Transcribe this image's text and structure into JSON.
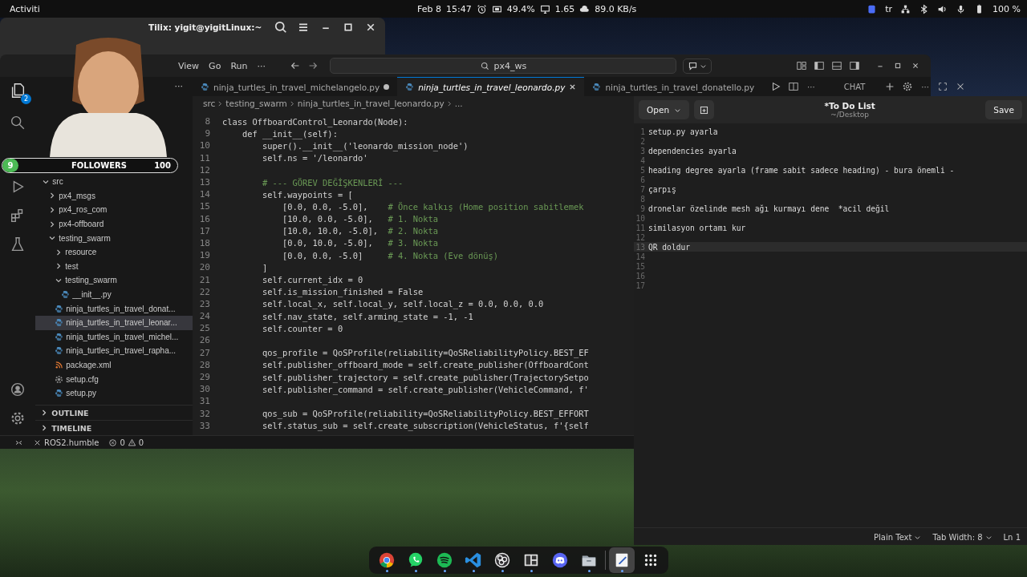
{
  "top_bar": {
    "activities": "Activiti",
    "date": "Feb 8",
    "time": "15:47",
    "indicators": [
      {
        "kind": "alarm"
      },
      {
        "kind": "cpu",
        "text": "49.4%"
      },
      {
        "kind": "monitor",
        "text": "1.65"
      },
      {
        "kind": "cloud",
        "text": "89.0 KB/s"
      }
    ],
    "tray": [
      {
        "kind": "badge"
      },
      {
        "kind": "lang",
        "text": "tr"
      },
      {
        "kind": "network"
      },
      {
        "kind": "bluetooth"
      },
      {
        "kind": "volume"
      },
      {
        "kind": "mic"
      },
      {
        "kind": "battery",
        "text": "100 %"
      }
    ]
  },
  "tilix": {
    "title": "Tilix: yigit@yigitLinux:~"
  },
  "followers": {
    "count": "9",
    "label": "FOLLOWERS",
    "goal": "100",
    "level": 0.09
  },
  "vscode": {
    "menu": [
      "View",
      "Go",
      "Run",
      "···"
    ],
    "search": "px4_ws",
    "explorer_more": "···",
    "activity_badge": "2",
    "tabs": [
      {
        "label": "ninja_turtles_in_travel_michelangelo.py",
        "selected": false,
        "modified": true,
        "preview": false
      },
      {
        "label": "ninja_turtles_in_travel_leonardo.py",
        "selected": true,
        "modified": false,
        "preview": true
      },
      {
        "label": "ninja_turtles_in_travel_donatello.py",
        "selected": false,
        "modified": false,
        "preview": false
      }
    ],
    "tab_more": "···",
    "chat_label": "CHAT",
    "chat_more": "···",
    "breadcrumb": [
      "src",
      "testing_swarm",
      "ninja_turtles_in_travel_leonardo.py",
      "..."
    ],
    "explorer": {
      "items": [
        {
          "label": "src",
          "kind": "folder",
          "expanded": true,
          "selected": false,
          "children": [
            {
              "label": "px4_msgs",
              "kind": "folder",
              "expanded": false,
              "selected": false
            },
            {
              "label": "px4_ros_com",
              "kind": "folder",
              "expanded": false,
              "selected": false
            },
            {
              "label": "px4-offboard",
              "kind": "folder",
              "expanded": false,
              "selected": false
            },
            {
              "label": "testing_swarm",
              "kind": "folder",
              "expanded": true,
              "selected": false,
              "children": [
                {
                  "label": "resource",
                  "kind": "folder",
                  "expanded": false,
                  "selected": false
                },
                {
                  "label": "test",
                  "kind": "folder",
                  "expanded": false,
                  "selected": false
                },
                {
                  "label": "testing_swarm",
                  "kind": "folder",
                  "expanded": true,
                  "selected": false,
                  "children": [
                    {
                      "label": "__init__.py",
                      "kind": "python",
                      "selected": false
                    }
                  ]
                },
                {
                  "label": "ninja_turtles_in_travel_donat...",
                  "kind": "python",
                  "selected": false
                },
                {
                  "label": "ninja_turtles_in_travel_leonar...",
                  "kind": "python",
                  "selected": true
                },
                {
                  "label": "ninja_turtles_in_travel_michel...",
                  "kind": "python",
                  "selected": false
                },
                {
                  "label": "ninja_turtles_in_travel_rapha...",
                  "kind": "python",
                  "selected": false
                },
                {
                  "label": "package.xml",
                  "kind": "xml",
                  "selected": false
                },
                {
                  "label": "setup.cfg",
                  "kind": "config",
                  "selected": false
                },
                {
                  "label": "setup.py",
                  "kind": "python",
                  "selected": false
                }
              ]
            }
          ]
        }
      ]
    },
    "sections": [
      {
        "label": "OUTLINE",
        "expanded": false
      },
      {
        "label": "TIMELINE",
        "expanded": false
      }
    ],
    "code": [
      {
        "num": "8",
        "code": "class OffboardControl_Leonardo(Node):"
      },
      {
        "num": "9",
        "code": "    def __init__(self):"
      },
      {
        "num": "10",
        "code": "        super().__init__('leonardo_mission_node')"
      },
      {
        "num": "11",
        "code": "        self.ns = '/leonardo'"
      },
      {
        "num": "12"
      },
      {
        "num": "13",
        "comment": "        # --- GÖREV DEĞİŞKENLERİ ---"
      },
      {
        "num": "14",
        "code": "        self.waypoints = ["
      },
      {
        "num": "15",
        "code": "            [0.0, 0.0, -5.0],    ",
        "comment": "# Önce kalkış (Home position sabitlemek"
      },
      {
        "num": "16",
        "code": "            [10.0, 0.0, -5.0],   ",
        "comment": "# 1. Nokta"
      },
      {
        "num": "17",
        "code": "            [10.0, 10.0, -5.0],  ",
        "comment": "# 2. Nokta"
      },
      {
        "num": "18",
        "code": "            [0.0, 10.0, -5.0],   ",
        "comment": "# 3. Nokta"
      },
      {
        "num": "19",
        "code": "            [0.0, 0.0, -5.0]     ",
        "comment": "# 4. Nokta (Eve dönüş)"
      },
      {
        "num": "20",
        "code": "        ]"
      },
      {
        "num": "21",
        "code": "        self.current_idx = 0"
      },
      {
        "num": "22",
        "code": "        self.is_mission_finished = False"
      },
      {
        "num": "23",
        "code": "        self.local_x, self.local_y, self.local_z = 0.0, 0.0, 0.0"
      },
      {
        "num": "24",
        "code": "        self.nav_state, self.arming_state = -1, -1"
      },
      {
        "num": "25",
        "code": "        self.counter = 0"
      },
      {
        "num": "26"
      },
      {
        "num": "27",
        "code": "        qos_profile = QoSProfile(reliability=QoSReliabilityPolicy.BEST_EF"
      },
      {
        "num": "28",
        "code": "        self.publisher_offboard_mode = self.create_publisher(OffboardCont"
      },
      {
        "num": "29",
        "code": "        self.publisher_trajectory = self.create_publisher(TrajectorySetpo"
      },
      {
        "num": "30",
        "code": "        self.publisher_command = self.create_publisher(VehicleCommand, f'"
      },
      {
        "num": "31"
      },
      {
        "num": "32",
        "code": "        qos_sub = QoSProfile(reliability=QoSReliabilityPolicy.BEST_EFFORT"
      },
      {
        "num": "33",
        "code": "        self.status_sub = self.create_subscription(VehicleStatus, f'{self"
      }
    ],
    "status": {
      "remote": "ROS2.humble",
      "errors": "0",
      "warnings": "0"
    }
  },
  "gedit": {
    "open": "Open",
    "title": "*To Do List",
    "subtitle": "~/Desktop",
    "save": "Save",
    "lines": [
      {
        "num": "1",
        "text": "setup.py ayarla",
        "current": false
      },
      {
        "num": "2",
        "current": false
      },
      {
        "num": "3",
        "text": "dependencies ayarla",
        "current": false
      },
      {
        "num": "4",
        "current": false
      },
      {
        "num": "5",
        "text": "heading degree ayarla (frame sabit sadece heading) - bura önemli -",
        "current": false
      },
      {
        "num": "6",
        "current": false
      },
      {
        "num": "7",
        "text": "çarpış",
        "current": false
      },
      {
        "num": "8",
        "current": false
      },
      {
        "num": "9",
        "text": "dronelar özelinde mesh ağı kurmayı dene  *acil değil",
        "current": false
      },
      {
        "num": "10",
        "current": false
      },
      {
        "num": "11",
        "text": "similasyon ortamı kur",
        "current": false
      },
      {
        "num": "12",
        "current": false
      },
      {
        "num": "13",
        "text": "QR doldur",
        "current": true
      },
      {
        "num": "14",
        "current": false
      },
      {
        "num": "15",
        "current": false
      },
      {
        "num": "16",
        "current": false
      },
      {
        "num": "17",
        "current": false
      }
    ],
    "status": {
      "language": "Plain Text",
      "tab_width": "Tab Width: 8",
      "position": "Ln 1"
    }
  },
  "dock": {
    "items": [
      {
        "kind": "browser",
        "running": true,
        "active": false
      },
      {
        "kind": "messenger",
        "running": true,
        "active": false
      },
      {
        "kind": "music",
        "running": true,
        "active": false
      },
      {
        "kind": "code",
        "running": true,
        "active": false
      },
      {
        "kind": "recorder",
        "running": true,
        "active": false
      },
      {
        "kind": "panels",
        "running": true,
        "active": false
      },
      {
        "kind": "voice",
        "running": false,
        "active": false
      },
      {
        "kind": "files",
        "running": true,
        "active": false
      },
      {
        "kind": "text-editor",
        "running": true,
        "active": true
      },
      {
        "kind": "grid",
        "running": false,
        "active": false
      }
    ]
  }
}
